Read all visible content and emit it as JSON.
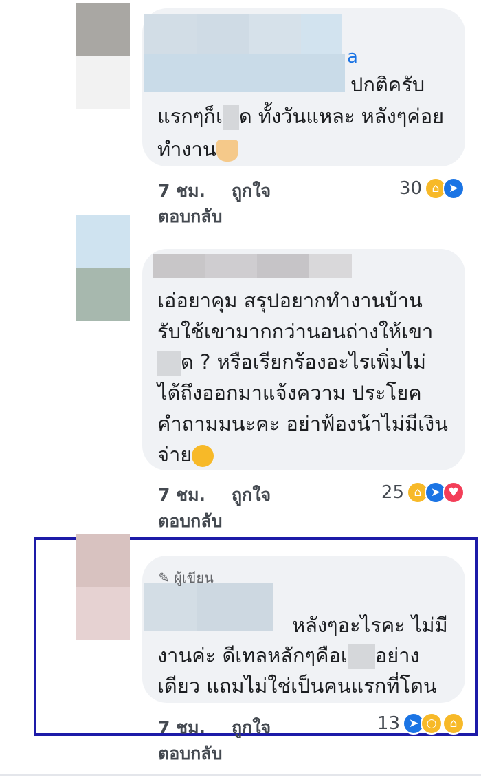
{
  "comments": [
    {
      "name_fragment": "a",
      "lines": [
        "ปกติครับ",
        "แรกๆก็เ",
        "ด ทั้งวันแหละ หลังๆค่อย",
        "ทำงาน"
      ],
      "emoji_end": "folded-hands",
      "time": "7 ชม.",
      "like_label": "ถูกใจ",
      "reply_label": "ตอบกลับ",
      "reaction_count": "30",
      "reactions": [
        "haha",
        "like"
      ]
    },
    {
      "lines": [
        "เอ่อยาคุม สรุปอยากทำงานบ้าน",
        "รับใช้เขามากกว่านอนถ่างให้เขา",
        "ด ? หรือเรียกร้องอะไรเพิ่มไม่",
        "ได้ถึงออกมาแจ้งความ ประโยค",
        "คำถามมนะคะ อย่าฟ้องน้าไม่มีเงิน",
        "จ่าย"
      ],
      "emoji_end": "smirk-face",
      "time": "7 ชม.",
      "like_label": "ถูกใจ",
      "reply_label": "ตอบกลับ",
      "reaction_count": "25",
      "reactions": [
        "haha",
        "like",
        "love"
      ]
    },
    {
      "author_badge": "ผู้เขียน",
      "lines": [
        "หลังๆอะไรคะ ไม่มี",
        "งานค่ะ ดีเทลหลักๆคือเ",
        "อย่าง",
        "เดียว แถมไม่ใช่เป็นคนแรกที่โดน"
      ],
      "time": "7 ชม.",
      "like_label": "ถูกใจ",
      "reply_label": "ตอบกลับ",
      "reaction_count": "13",
      "reactions": [
        "like",
        "wow",
        "haha"
      ]
    }
  ],
  "colors": {
    "bubble": "#f0f2f5",
    "highlight_border": "#1d1ba8",
    "like": "#1b74e4",
    "love": "#f33e58",
    "haha": "#f7b928"
  }
}
